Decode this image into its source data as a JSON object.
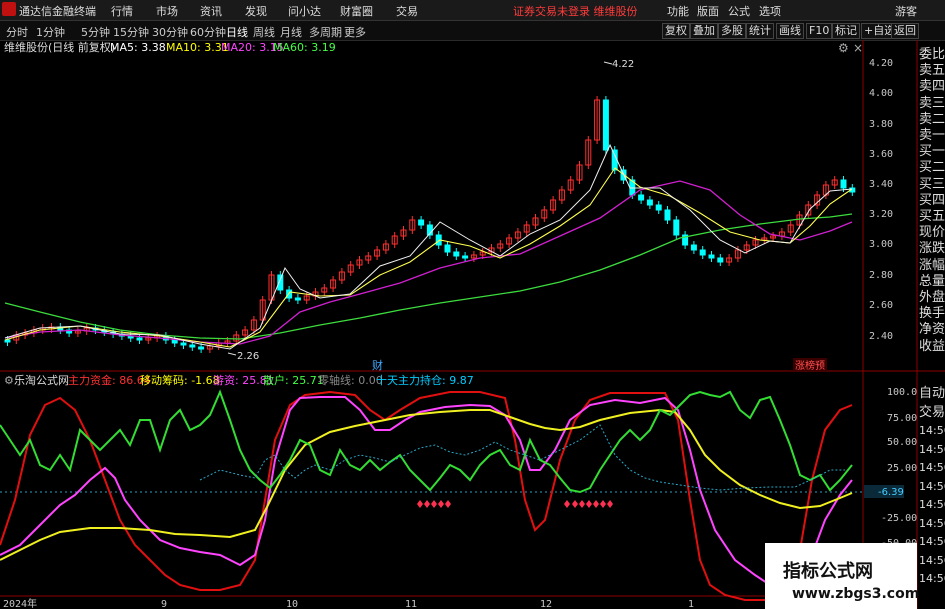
{
  "app": {
    "name": "通达信金融终端",
    "menus": [
      "行情",
      "市场",
      "资讯",
      "发现",
      "问小达",
      "财富圈",
      "交易"
    ],
    "notice": "证券交易未登录  维维股份",
    "right_menus": [
      "功能",
      "版面",
      "公式",
      "选项"
    ],
    "user": "游客"
  },
  "period": {
    "items": [
      "分时",
      "1分钟",
      "5分钟",
      "15分钟",
      "30分钟",
      "60分钟",
      "日线",
      "周线",
      "月线",
      "多周期",
      "更多"
    ],
    "active": "日线",
    "tools": [
      "复权",
      "叠加",
      "多股",
      "统计",
      "画线",
      "F10",
      "标记",
      "+自选",
      "返回"
    ]
  },
  "main": {
    "title": "维维股份(日线 前复权)",
    "ma": [
      {
        "label": "MA5: 3.38",
        "color": "#ffffff"
      },
      {
        "label": "MA10: 3.31",
        "color": "#ffff00"
      },
      {
        "label": "MA20: 3.15",
        "color": "#ff44ff"
      },
      {
        "label": "MA60: 3.19",
        "color": "#44ff44"
      }
    ],
    "ticks": [
      "4.20",
      "4.00",
      "3.80",
      "3.60",
      "3.40",
      "3.20",
      "3.00",
      "2.80",
      "2.60",
      "2.40"
    ],
    "high_label": "4.22",
    "low_label": "2.26",
    "cai_label": "财",
    "badge": "涨榜预"
  },
  "sub": {
    "title": "乐淘公式网",
    "items": [
      {
        "label": "主力资金: 86.64",
        "color": "#ff3030"
      },
      {
        "label": "移动筹码: -1.68",
        "color": "#ffff00"
      },
      {
        "label": "游资: 25.81",
        "color": "#ff44ff"
      },
      {
        "label": "散户: 25.71",
        "color": "#44ff44"
      },
      {
        "label": "零轴线: 0.00",
        "color": "#888888"
      },
      {
        "label": "十天主力持仓: 9.87",
        "color": "#00ccff"
      }
    ],
    "ticks": [
      "100.0",
      "75.00",
      "50.00",
      "25.00",
      "-25.00",
      "-50.00"
    ],
    "current": "-6.39"
  },
  "xaxis": [
    "2024年",
    "9",
    "10",
    "11",
    "12",
    "1"
  ],
  "side": [
    "委比",
    "卖五",
    "卖四",
    "卖三",
    "卖二",
    "卖一",
    "买一",
    "买二",
    "买三",
    "买四",
    "买五",
    "现价",
    "涨跌",
    "涨幅",
    "总量",
    "外盘",
    "换手",
    "净资",
    "收益"
  ],
  "side2": [
    "自动",
    "交易",
    "14:56",
    "14:56",
    "14:56",
    "14:56",
    "14:56",
    "14:56",
    "14:56",
    "14:56",
    "14:56"
  ],
  "watermark": {
    "title": "指标公式网",
    "url": "www.zbgs3.com"
  },
  "colors": {
    "up": "#ff3030",
    "down": "#00ffff",
    "bg": "#000000"
  }
}
